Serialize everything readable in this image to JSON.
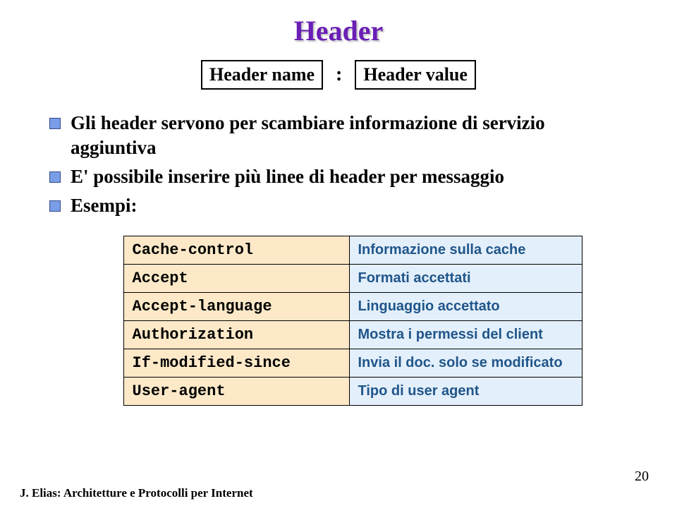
{
  "title": "Header",
  "headerName": "Header name",
  "colon": ":",
  "headerValue": "Header value",
  "bullets": [
    "Gli header servono per scambiare informazione di servizio aggiuntiva",
    "E' possibile inserire più linee di header per messaggio",
    "Esempi:"
  ],
  "table": [
    {
      "code": "Cache-control",
      "desc": "Informazione sulla cache"
    },
    {
      "code": "Accept",
      "desc": "Formati accettati"
    },
    {
      "code": "Accept-language",
      "desc": "Linguaggio accettato"
    },
    {
      "code": "Authorization",
      "desc": "Mostra i permessi del client"
    },
    {
      "code": "If-modified-since",
      "desc": "Invia il doc. solo se modificato"
    },
    {
      "code": "User-agent",
      "desc": "Tipo di user agent"
    }
  ],
  "footer": "J. Elias: Architetture e Protocolli per Internet",
  "pageNum": "20"
}
